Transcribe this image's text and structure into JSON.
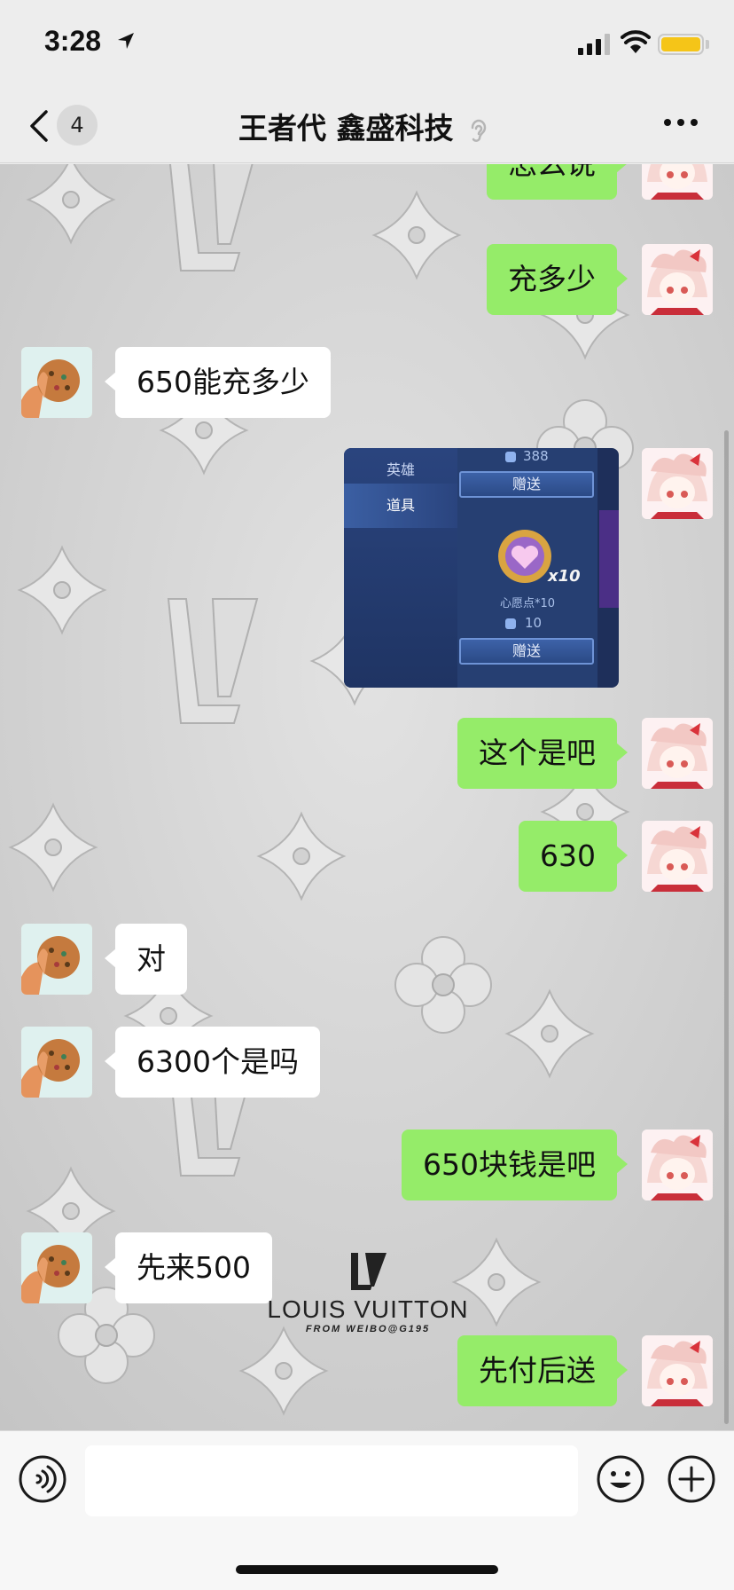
{
  "status": {
    "time": "3:28"
  },
  "header": {
    "back_badge": "4",
    "title": "王者代 鑫盛科技"
  },
  "messages": [
    {
      "side": "out",
      "text": "怎么说"
    },
    {
      "side": "out",
      "text": "充多少"
    },
    {
      "side": "in",
      "text": "650能充多少"
    },
    {
      "side": "out",
      "type": "image"
    },
    {
      "side": "out",
      "text": "这个是吧"
    },
    {
      "side": "out",
      "text": "630"
    },
    {
      "side": "in",
      "text": "对"
    },
    {
      "side": "in",
      "text": "6300个是吗"
    },
    {
      "side": "out",
      "text": "650块钱是吧"
    },
    {
      "side": "in",
      "text": "先来500"
    },
    {
      "side": "out",
      "text": "先付后送"
    }
  ],
  "image_content": {
    "tab_hero": "英雄",
    "tab_item": "道具",
    "price_top": "388",
    "gift_button": "赠送",
    "item_name": "心愿点*10",
    "item_multiplier": "x10",
    "price_bottom": "10"
  },
  "watermark": {
    "brand": "LOUIS VUITTON",
    "credit": "FROM WEIBO@G195"
  },
  "input": {
    "value": ""
  }
}
